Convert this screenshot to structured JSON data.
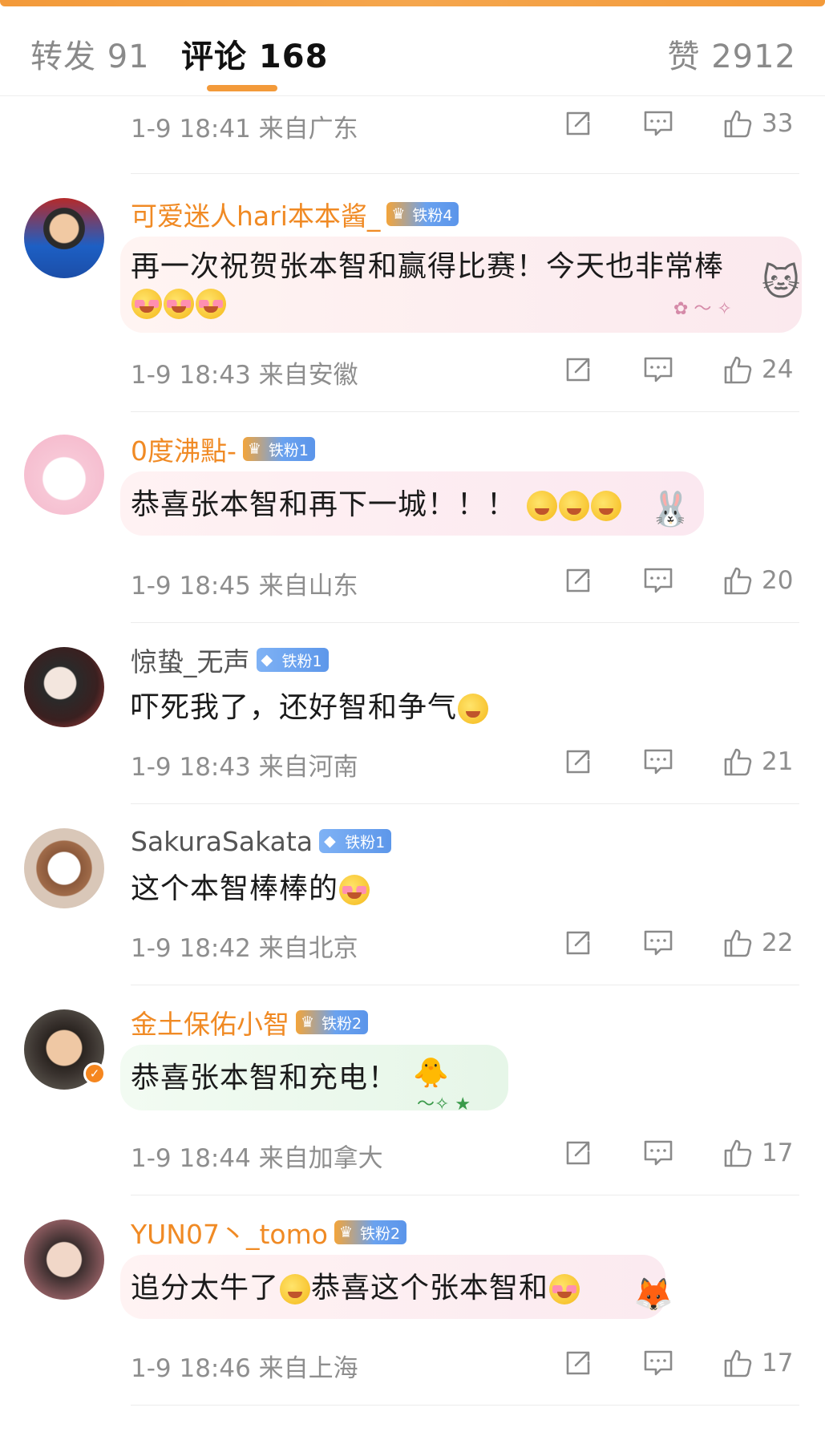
{
  "tabs": {
    "repost_label": "转发 91",
    "comment_label": "评论 168",
    "like_label": "赞 2912"
  },
  "colors": {
    "accent": "#f39a3a",
    "username_orange": "#f08a24",
    "meta_gray": "#8e8e8e"
  },
  "first_meta": {
    "time": "1-9 18:41 来自广东",
    "like_count": "33"
  },
  "comments": [
    {
      "username": "可爱迷人hari本本酱_",
      "badge": "铁粉4",
      "text": "再一次祝贺张本智和赢得比赛！今天也非常棒",
      "time": "1-9 18:43 来自安徽",
      "like_count": "24"
    },
    {
      "username": "0度沸點-",
      "badge": "铁粉1",
      "text": "恭喜张本智和再下一城！！！",
      "time": "1-9 18:45 来自山东",
      "like_count": "20"
    },
    {
      "username": "惊蛰_无声",
      "badge": "铁粉1",
      "text": "吓死我了，还好智和争气",
      "time": "1-9 18:43 来自河南",
      "like_count": "21"
    },
    {
      "username": "SakuraSakata",
      "badge": "铁粉1",
      "text": "这个本智棒棒的",
      "time": "1-9 18:42 来自北京",
      "like_count": "22"
    },
    {
      "username": "金土保佑小智",
      "badge": "铁粉2",
      "text": "恭喜张本智和充电！",
      "time": "1-9 18:44 来自加拿大",
      "like_count": "17"
    },
    {
      "username": "YUN07丶_tomo",
      "badge": "铁粉2",
      "text": "追分太牛了",
      "text2": "恭喜这个张本智和",
      "time": "1-9 18:46 来自上海",
      "like_count": "17"
    }
  ]
}
